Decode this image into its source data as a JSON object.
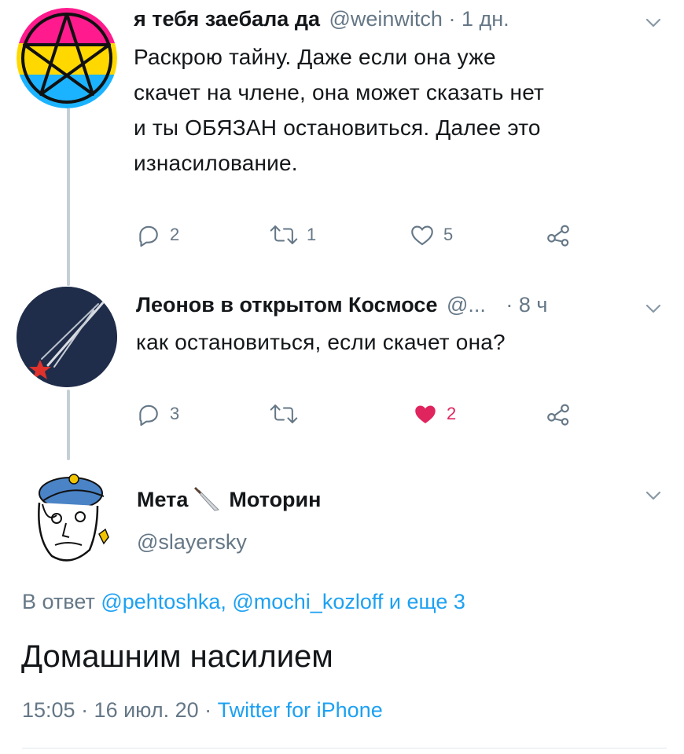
{
  "tweets": [
    {
      "display_name": "я тебя заебала да",
      "handle": "@weinwitch",
      "time": "· 1 дн.",
      "text": "Раскрою тайну. Даже если она уже скачет на члене, она может сказать нет и ты ОБЯЗАН остановиться. Далее это изнасилование.",
      "text_lines": [
        "Раскрою тайну. Даже если она уже",
        "скачет на члене, она может сказать нет",
        "и ты ОБЯЗАН остановиться. Далее это",
        "изнасилование."
      ],
      "replies": "2",
      "retweets": "1",
      "likes": "5"
    },
    {
      "display_name": "Леонов в открытом Космосе",
      "handle": "@...",
      "time": "· 8 ч",
      "text": "как остановиться, если скачет она?",
      "replies": "3",
      "retweets": "",
      "likes": "2",
      "liked": true
    }
  ],
  "main_tweet": {
    "display_name_first": "Мета",
    "display_name_second": "Моторин",
    "handle": "@slayersky",
    "reply_prefix": "В ответ",
    "reply_to_1": "@pehtoshka,",
    "reply_to_2": "@mochi_kozloff",
    "reply_suffix": "и еще 3",
    "text": "Домашним насилием",
    "timestamp": "15:05 · 16 июл. 20 ·",
    "client": "Twitter for iPhone"
  },
  "colors": {
    "text": "#14171a",
    "muted": "#657786",
    "link": "#1da1f2",
    "like": "#e0245e",
    "thread_line": "#c4cfd6"
  },
  "icons": [
    "pentagram-avatar",
    "comet-avatar",
    "meme-face-avatar",
    "chevron-down-icon",
    "reply-icon",
    "retweet-icon",
    "like-icon",
    "share-icon",
    "knife-emoji"
  ]
}
